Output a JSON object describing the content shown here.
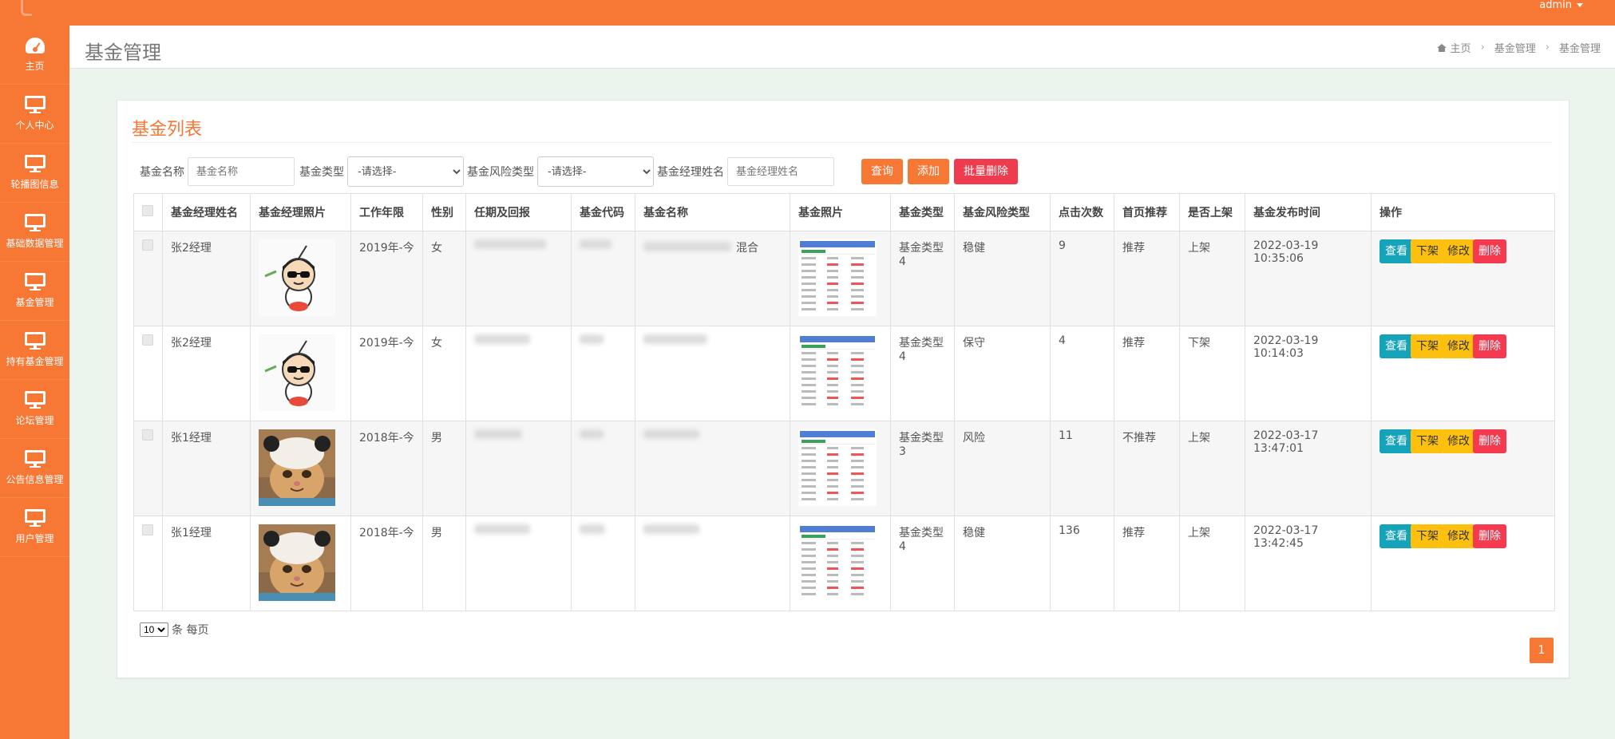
{
  "topbar": {
    "user": "admin"
  },
  "sidebar": {
    "items": [
      {
        "label": "主页",
        "icon": "dashboard-icon"
      },
      {
        "label": "个人中心",
        "icon": "monitor-icon"
      },
      {
        "label": "轮播图信息",
        "icon": "monitor-icon"
      },
      {
        "label": "基础数据管理",
        "icon": "monitor-icon"
      },
      {
        "label": "基金管理",
        "icon": "monitor-icon"
      },
      {
        "label": "持有基金管理",
        "icon": "monitor-icon"
      },
      {
        "label": "论坛管理",
        "icon": "monitor-icon"
      },
      {
        "label": "公告信息管理",
        "icon": "monitor-icon"
      },
      {
        "label": "用户管理",
        "icon": "monitor-icon"
      }
    ]
  },
  "header": {
    "title": "基金管理",
    "breadcrumb": [
      "主页",
      "基金管理",
      "基金管理"
    ]
  },
  "card": {
    "title": "基金列表"
  },
  "search": {
    "fund_name_label": "基金名称",
    "fund_name_placeholder": "基金名称",
    "fund_type_label": "基金类型",
    "fund_type_value": "-请选择-",
    "risk_type_label": "基金风险类型",
    "risk_type_value": "-请选择-",
    "manager_name_label": "基金经理姓名",
    "manager_name_placeholder": "基金经理姓名",
    "query_button": "查询",
    "add_button": "添加",
    "batch_delete_button": "批量删除"
  },
  "table": {
    "columns": [
      "基金经理姓名",
      "基金经理照片",
      "工作年限",
      "性别",
      "任期及回报",
      "基金代码",
      "基金名称",
      "基金照片",
      "基金类型",
      "基金风险类型",
      "点击次数",
      "首页推荐",
      "是否上架",
      "基金发布时间",
      "操作"
    ],
    "rows": [
      {
        "manager": "张2经理",
        "avatar": "cartoon",
        "years": "2019年-今",
        "gender": "女",
        "fund_name_tail": "混合",
        "fund_type": "基金类型4",
        "risk": "稳健",
        "clicks": "9",
        "recommend": "推荐",
        "listed": "上架",
        "published": "2022-03-19 10:35:06"
      },
      {
        "manager": "张2经理",
        "avatar": "cartoon",
        "years": "2019年-今",
        "gender": "女",
        "fund_name_tail": "",
        "fund_type": "基金类型4",
        "risk": "保守",
        "clicks": "4",
        "recommend": "推荐",
        "listed": "下架",
        "published": "2022-03-19 10:14:03"
      },
      {
        "manager": "张1经理",
        "avatar": "cat",
        "years": "2018年-今",
        "gender": "男",
        "fund_name_tail": "",
        "fund_type": "基金类型3",
        "risk": "风险",
        "clicks": "11",
        "recommend": "不推荐",
        "listed": "上架",
        "published": "2022-03-17 13:47:01"
      },
      {
        "manager": "张1经理",
        "avatar": "cat",
        "years": "2018年-今",
        "gender": "男",
        "fund_name_tail": "",
        "fund_type": "基金类型4",
        "risk": "稳健",
        "clicks": "136",
        "recommend": "推荐",
        "listed": "上架",
        "published": "2022-03-17 13:42:45"
      }
    ],
    "actions": {
      "view": "查看",
      "unlist": "下架",
      "edit": "修改",
      "delete": "删除"
    }
  },
  "pager": {
    "page_size": "10",
    "per_page_text": "条 每页",
    "current_page": "1"
  },
  "colors": {
    "accent": "#f77735",
    "teal": "#14a3b8",
    "yellow": "#fdc00e",
    "danger": "#f5394f"
  }
}
